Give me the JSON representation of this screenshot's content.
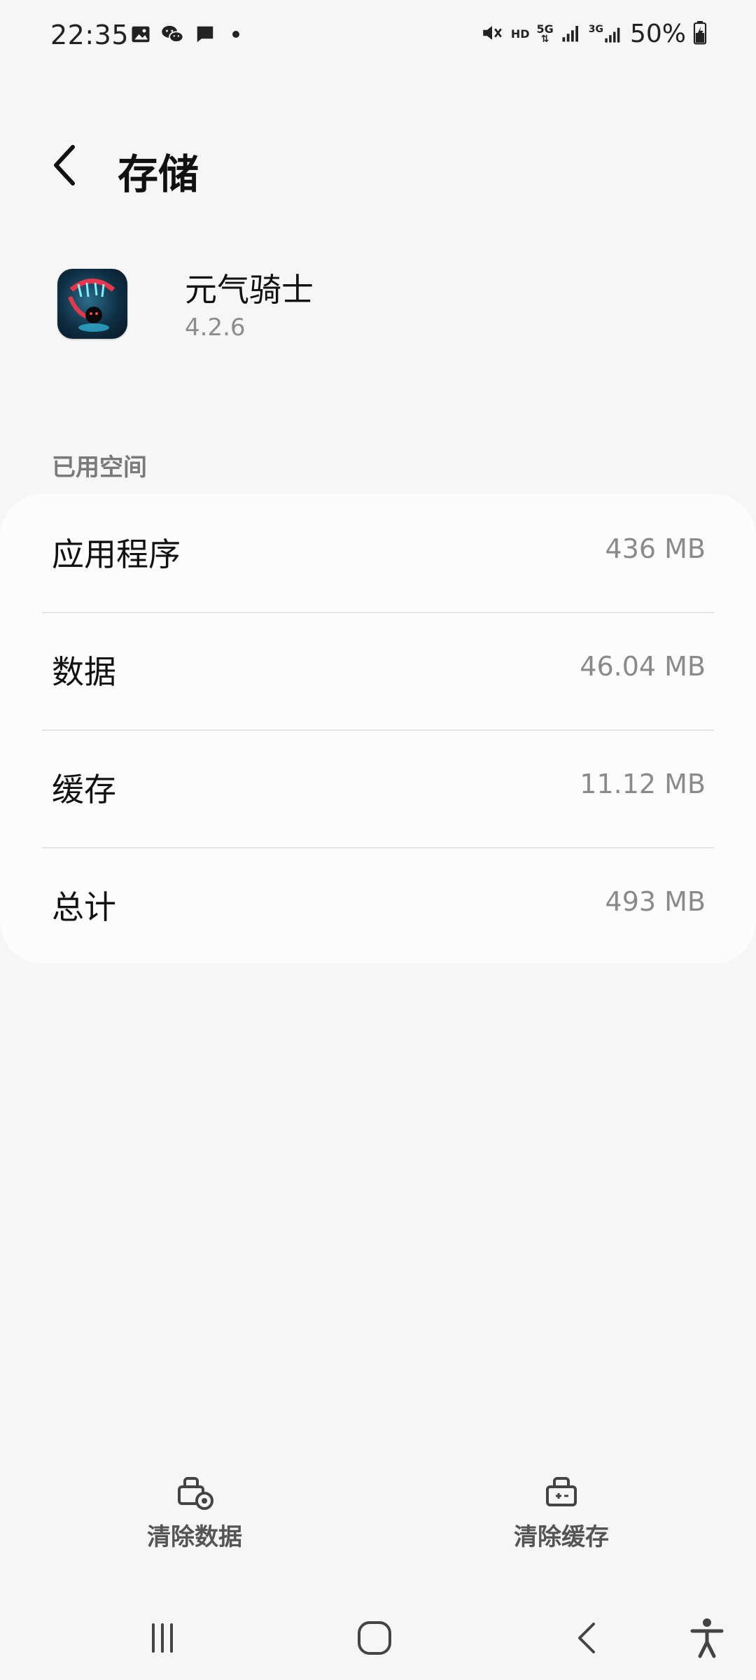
{
  "status_bar": {
    "time": "22:35",
    "battery_percent": "50%",
    "network_labels": [
      "HD",
      "5G",
      "3G"
    ],
    "left_icons": [
      "image-icon",
      "wechat-icon",
      "message-icon",
      "dot-icon"
    ],
    "right_icons": [
      "mute-icon",
      "hd-icon",
      "5g-icon",
      "signal-icon",
      "3g-signal-icon",
      "battery-icon"
    ]
  },
  "header": {
    "title": "存储",
    "back_icon": "chevron-left-icon"
  },
  "app": {
    "name": "元气骑士",
    "version": "4.2.6",
    "icon": "soul-knight-app-icon"
  },
  "storage": {
    "section_label": "已用空间",
    "rows": [
      {
        "label": "应用程序",
        "value": "436 MB"
      },
      {
        "label": "数据",
        "value": "46.04 MB"
      },
      {
        "label": "缓存",
        "value": "11.12 MB"
      },
      {
        "label": "总计",
        "value": "493 MB"
      }
    ]
  },
  "actions": {
    "clear_data": {
      "label": "清除数据",
      "icon": "clear-data-icon"
    },
    "clear_cache": {
      "label": "清除缓存",
      "icon": "clear-cache-icon"
    }
  },
  "nav": {
    "icons": [
      "recent-apps-icon",
      "home-icon",
      "back-icon",
      "accessibility-icon"
    ]
  },
  "colors": {
    "background": "#f6f6f6",
    "card": "#fcfcfc",
    "secondary_text": "#8a8a8a"
  }
}
